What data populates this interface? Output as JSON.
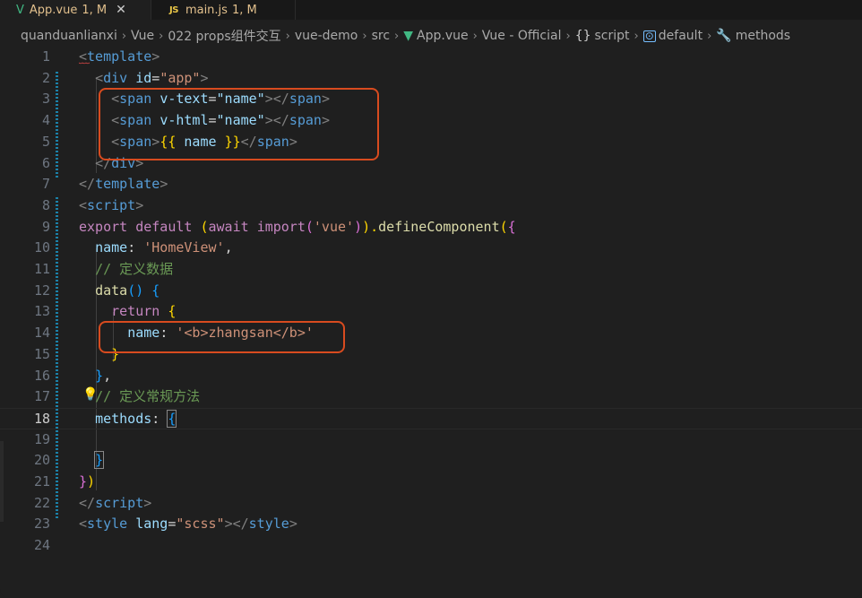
{
  "tabs": [
    {
      "icon": "V",
      "name": "App.vue",
      "status": "1, M",
      "close": "✕"
    },
    {
      "icon": "JS",
      "name": "main.js",
      "status": "1, M"
    }
  ],
  "breadcrumb": {
    "items": [
      "quanduanlianxi",
      "Vue",
      "022 props组件交互",
      "vue-demo",
      "src",
      "App.vue",
      "Vue - Official",
      "script",
      "default",
      "methods"
    ],
    "separator": "›"
  },
  "editor": {
    "active_line": 18,
    "lines": [
      {
        "n": "1"
      },
      {
        "n": "2"
      },
      {
        "n": "3"
      },
      {
        "n": "4"
      },
      {
        "n": "5"
      },
      {
        "n": "6"
      },
      {
        "n": "7"
      },
      {
        "n": "8"
      },
      {
        "n": "9"
      },
      {
        "n": "10"
      },
      {
        "n": "11"
      },
      {
        "n": "12"
      },
      {
        "n": "13"
      },
      {
        "n": "14"
      },
      {
        "n": "15"
      },
      {
        "n": "16"
      },
      {
        "n": "17"
      },
      {
        "n": "18"
      },
      {
        "n": "19"
      },
      {
        "n": "20"
      },
      {
        "n": "21"
      },
      {
        "n": "22"
      },
      {
        "n": "23"
      },
      {
        "n": "24"
      }
    ],
    "tokens": {
      "l1": [
        "<",
        "template",
        ">"
      ],
      "l2": [
        "<",
        "div",
        "id",
        "=",
        "\"app\"",
        ">"
      ],
      "l3": [
        "<",
        "span",
        "v-text",
        "=",
        "\"name\"",
        "></",
        "span",
        ">"
      ],
      "l4": [
        "<",
        "span",
        "v-html",
        "=",
        "\"name\"",
        "></",
        "span",
        ">"
      ],
      "l5": [
        "<",
        "span",
        ">",
        "{{",
        "name",
        "}}",
        "</",
        "span",
        ">"
      ],
      "l6": [
        "</",
        "div",
        ">"
      ],
      "l7": [
        "</",
        "template",
        ">"
      ],
      "l8": [
        "<",
        "script",
        ">"
      ],
      "l9": [
        "export",
        "default",
        "(",
        "await",
        "import",
        "(",
        "'vue'",
        ")",
        ").",
        "defineComponent",
        "(",
        "{"
      ],
      "l10": [
        "name",
        ":",
        "'HomeView'",
        ","
      ],
      "l11": [
        "// 定义数据"
      ],
      "l12": [
        "data",
        "()",
        "{"
      ],
      "l13": [
        "return",
        "{"
      ],
      "l14": [
        "name",
        ":",
        "'<b>zhangsan</b>'"
      ],
      "l15": [
        "}"
      ],
      "l16": [
        "}",
        ","
      ],
      "l17": [
        "// 定义常规方法"
      ],
      "l18": [
        "methods",
        ":",
        "{"
      ],
      "l20": [
        "}"
      ],
      "l21": [
        "}",
        ")"
      ],
      "l22": [
        "</",
        "script",
        ">"
      ],
      "l23": [
        "<",
        "style",
        "lang",
        "=",
        "\"scss\"",
        "></",
        "style",
        ">"
      ]
    }
  },
  "colors": {
    "tag": "#569cd6",
    "attr": "#9cdcfe",
    "string": "#ce9178",
    "keyword": "#c586c0",
    "function": "#dcdcaa",
    "comment": "#6a9955",
    "bracket1": "#ffd700",
    "bracket2": "#da70d6",
    "bracket3": "#179fff",
    "highlight_box": "#d84b1f",
    "vue_icon": "#41b883",
    "modified": "#e2c08d"
  },
  "icons": [
    "vue-icon",
    "js-icon",
    "close-icon",
    "braces-icon",
    "variable-icon",
    "wrench-icon",
    "lightbulb-icon"
  ]
}
